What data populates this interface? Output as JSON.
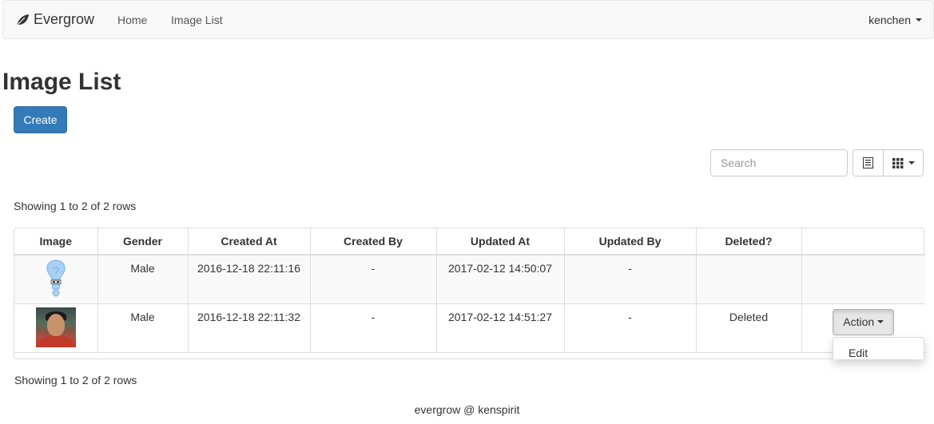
{
  "navbar": {
    "brand": "Evergrow",
    "links": [
      "Home",
      "Image List"
    ],
    "user": "kenchen"
  },
  "page": {
    "title": "Image List",
    "create_label": "Create"
  },
  "toolbar": {
    "search_placeholder": "Search",
    "icons": [
      "list-view-icon",
      "columns-grid-icon"
    ]
  },
  "pagination": {
    "top": "Showing 1 to 2 of 2 rows",
    "bottom": "Showing 1 to 2 of 2 rows"
  },
  "table": {
    "columns": [
      "Image",
      "Gender",
      "Created At",
      "Created By",
      "Updated At",
      "Updated By",
      "Deleted?",
      ""
    ],
    "rows": [
      {
        "image": "lightbulb-placeholder-icon",
        "gender": "Male",
        "created_at": "2016-12-18 22:11:16",
        "created_by": "-",
        "updated_at": "2017-02-12 14:50:07",
        "updated_by": "-",
        "deleted": "",
        "action": ""
      },
      {
        "image": "user-photo",
        "gender": "Male",
        "created_at": "2016-12-18 22:11:32",
        "created_by": "-",
        "updated_at": "2017-02-12 14:51:27",
        "updated_by": "-",
        "deleted": "Deleted",
        "action": "Action"
      }
    ]
  },
  "dropdown": {
    "items": [
      "Edit"
    ]
  },
  "footer": {
    "text": "evergrow @ kenspirit"
  },
  "colors": {
    "primary": "#337ab7",
    "navbar_bg": "#f8f8f8",
    "striped_row": "#f9f9f9"
  }
}
